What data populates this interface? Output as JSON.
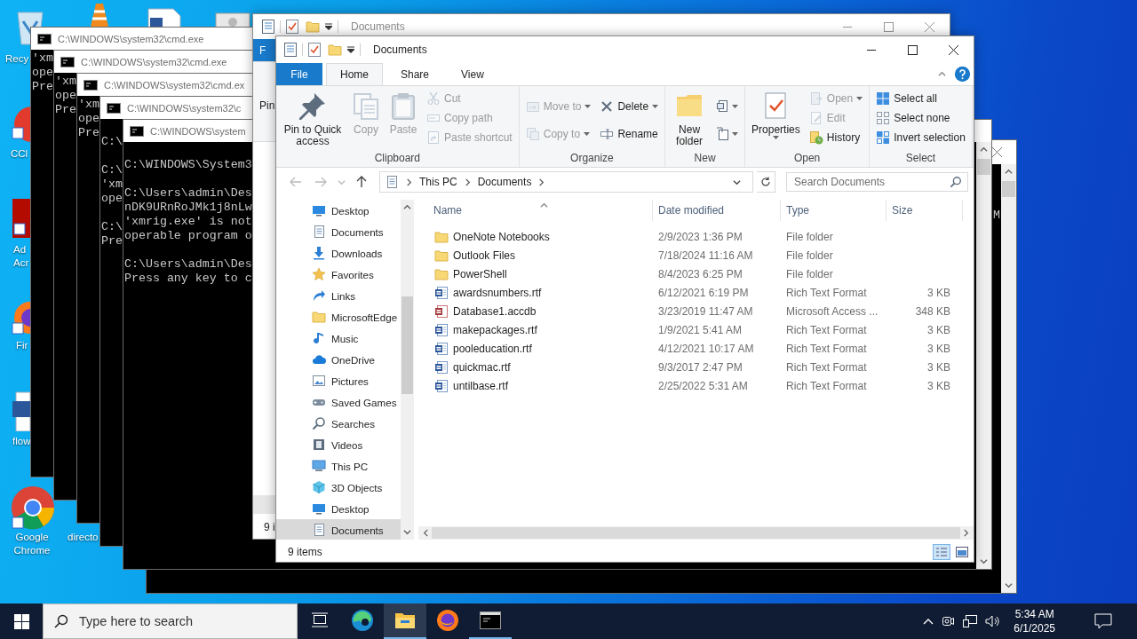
{
  "desktop_icons": [
    {
      "lines": [
        "Recy"
      ]
    },
    {
      "lines": [
        "CCl"
      ]
    },
    {
      "lines": [
        "Ad",
        "Acr"
      ]
    },
    {
      "lines": [
        "Fir"
      ]
    },
    {
      "lines": [
        "flow"
      ]
    },
    {
      "lines": [
        "Google",
        "Chrome"
      ]
    },
    {
      "lines": [
        "directo"
      ]
    }
  ],
  "cmd_windows": [
    {
      "title": "C:\\WINDOWS\\system32\\cmd.exe",
      "blocks": [
        [
          "'xm",
          "ope",
          "Pre"
        ]
      ]
    },
    {
      "title": "C:\\WINDOWS\\system32\\cmd.exe",
      "blocks": [
        [
          "'xm",
          "ope",
          "Pre"
        ]
      ]
    },
    {
      "title": "C:\\WINDOWS\\system32\\cmd.ex",
      "blocks": [
        [
          "'xm",
          "ope",
          "Pre"
        ]
      ]
    },
    {
      "title": "C:\\WINDOWS\\system32\\c",
      "blocks": [
        [
          "C:\\"
        ],
        [
          "C:\\",
          "'xm",
          "ope"
        ],
        [
          "C:\\",
          "Pre"
        ]
      ]
    },
    {
      "title": "C:\\WINDOWS\\system",
      "blocks": [
        [
          "C:\\WINDOWS\\System3"
        ],
        [
          "C:\\Users\\admin\\Des",
          "nDK9URnRoJMk1j8nLw",
          "'xmrig.exe' is not",
          "operable program o"
        ],
        [
          "C:\\Users\\admin\\Des",
          "Press any key to c"
        ]
      ]
    }
  ],
  "cmd_back_window": {
    "text": "M"
  },
  "explorer_back": {
    "title": "Documents",
    "file_tab": "F",
    "ribbon_text": "Pin",
    "status": "9 i"
  },
  "explorer": {
    "title": "Documents",
    "file_tab": "File",
    "tabs": [
      {
        "label": "Home",
        "selected": true
      },
      {
        "label": "Share",
        "selected": false
      },
      {
        "label": "View",
        "selected": false
      }
    ],
    "ribbon": [
      {
        "label": "Clipboard",
        "columns": [
          [
            {
              "kind": "large",
              "label": "Pin to Quick access",
              "disabled": false,
              "dropdown": false
            }
          ],
          [
            {
              "kind": "large",
              "label": "Copy",
              "disabled": true,
              "dropdown": false
            }
          ],
          [
            {
              "kind": "large",
              "label": "Paste",
              "disabled": true,
              "dropdown": false
            }
          ],
          [
            {
              "kind": "small",
              "label": "Cut",
              "disabled": true,
              "dropdown": false
            },
            {
              "kind": "small",
              "label": "Copy path",
              "disabled": true,
              "dropdown": false
            },
            {
              "kind": "small",
              "label": "Paste shortcut",
              "disabled": true,
              "dropdown": false
            }
          ]
        ]
      },
      {
        "label": "Organize",
        "columns": [
          [
            {
              "kind": "small",
              "label": "Move to",
              "disabled": true,
              "dropdown": true
            },
            {
              "kind": "small",
              "label": "Copy to",
              "disabled": true,
              "dropdown": true
            }
          ],
          [
            {
              "kind": "small",
              "label": "Delete",
              "disabled": false,
              "dropdown": true
            },
            {
              "kind": "small",
              "label": "Rename",
              "disabled": false,
              "dropdown": false
            }
          ]
        ]
      },
      {
        "label": "New",
        "columns": [
          [
            {
              "kind": "large",
              "label": "New folder",
              "disabled": false,
              "dropdown": false
            }
          ],
          [
            {
              "kind": "icon",
              "disabled": false,
              "dropdown": true
            },
            {
              "kind": "icon",
              "disabled": false,
              "dropdown": true
            }
          ]
        ]
      },
      {
        "label": "Open",
        "columns": [
          [
            {
              "kind": "large",
              "label": "Properties",
              "disabled": false,
              "dropdown": true
            }
          ],
          [
            {
              "kind": "small",
              "label": "Open",
              "disabled": true,
              "dropdown": true
            },
            {
              "kind": "small",
              "label": "Edit",
              "disabled": true,
              "dropdown": false
            },
            {
              "kind": "small",
              "label": "History",
              "disabled": false,
              "dropdown": false
            }
          ]
        ]
      },
      {
        "label": "Select",
        "columns": [
          [
            {
              "kind": "small",
              "label": "Select all",
              "disabled": false,
              "dropdown": false
            },
            {
              "kind": "small",
              "label": "Select none",
              "disabled": false,
              "dropdown": false
            },
            {
              "kind": "small",
              "label": "Invert selection",
              "disabled": false,
              "dropdown": false
            }
          ]
        ]
      }
    ],
    "address": [
      "This PC",
      "Documents"
    ],
    "search_placeholder": "Search Documents",
    "nav": [
      {
        "label": "Desktop",
        "selected": false
      },
      {
        "label": "Documents",
        "selected": false
      },
      {
        "label": "Downloads",
        "selected": false
      },
      {
        "label": "Favorites",
        "selected": false
      },
      {
        "label": "Links",
        "selected": false
      },
      {
        "label": "MicrosoftEdge",
        "selected": false
      },
      {
        "label": "Music",
        "selected": false
      },
      {
        "label": "OneDrive",
        "selected": false
      },
      {
        "label": "Pictures",
        "selected": false
      },
      {
        "label": "Saved Games",
        "selected": false
      },
      {
        "label": "Searches",
        "selected": false
      },
      {
        "label": "Videos",
        "selected": false
      },
      {
        "label": "This PC",
        "selected": false,
        "children": [
          {
            "label": "3D Objects",
            "selected": false
          },
          {
            "label": "Desktop",
            "selected": false
          },
          {
            "label": "Documents",
            "selected": true
          }
        ]
      }
    ],
    "columns": [
      "Name",
      "Date modified",
      "Type",
      "Size"
    ],
    "rows": [
      {
        "kind": "folder",
        "name": "OneNote Notebooks",
        "date": "2/9/2023 1:36 PM",
        "type": "File folder"
      },
      {
        "kind": "folder",
        "name": "Outlook Files",
        "date": "7/18/2024 11:16 AM",
        "type": "File folder"
      },
      {
        "kind": "folder",
        "name": "PowerShell",
        "date": "8/4/2023 6:25 PM",
        "type": "File folder"
      },
      {
        "kind": "word",
        "name": "awardsnumbers.rtf",
        "date": "6/12/2021 6:19 PM",
        "type": "Rich Text Format",
        "size": "3 KB"
      },
      {
        "kind": "access",
        "name": "Database1.accdb",
        "date": "3/23/2019 11:47 AM",
        "type": "Microsoft Access ...",
        "size": "348 KB"
      },
      {
        "kind": "word",
        "name": "makepackages.rtf",
        "date": "1/9/2021 5:41 AM",
        "type": "Rich Text Format",
        "size": "3 KB"
      },
      {
        "kind": "word",
        "name": "pooleducation.rtf",
        "date": "4/12/2021 10:17 AM",
        "type": "Rich Text Format",
        "size": "3 KB"
      },
      {
        "kind": "word",
        "name": "quickmac.rtf",
        "date": "9/3/2017 2:47 PM",
        "type": "Rich Text Format",
        "size": "3 KB"
      },
      {
        "kind": "word",
        "name": "untilbase.rtf",
        "date": "2/25/2022 5:31 AM",
        "type": "Rich Text Format",
        "size": "3 KB"
      }
    ],
    "status": "9 items",
    "views": [
      {
        "kind": "details",
        "selected": true
      },
      {
        "kind": "thumbnails",
        "selected": false
      }
    ]
  },
  "taskbar": {
    "search_placeholder": "Type here to search",
    "apps": [
      {
        "kind": "taskview",
        "running": false,
        "selected": false
      },
      {
        "kind": "edge",
        "running": false,
        "selected": false
      },
      {
        "kind": "explorer",
        "running": true,
        "selected": true
      },
      {
        "kind": "firefox",
        "running": false,
        "selected": false
      },
      {
        "kind": "terminal",
        "running": true,
        "selected": false
      }
    ],
    "time": "5:34 AM",
    "date": "6/1/2025"
  }
}
